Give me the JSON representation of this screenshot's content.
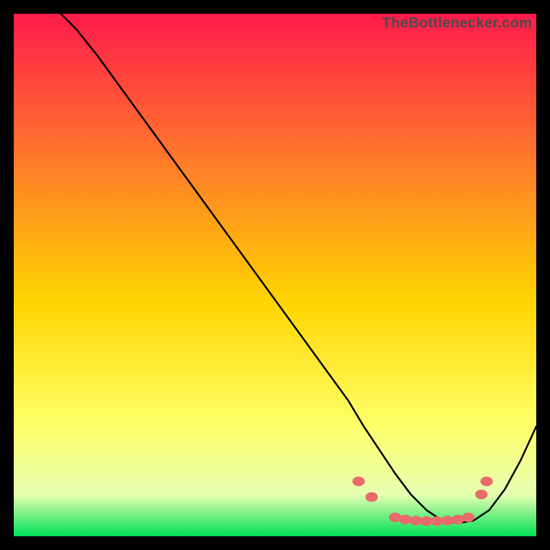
{
  "watermark": "TheBottlenecker.com",
  "chart_data": {
    "type": "line",
    "title": "",
    "xlabel": "",
    "ylabel": "",
    "xlim": [
      0,
      100
    ],
    "ylim": [
      0,
      100
    ],
    "grid": false,
    "background_gradient": {
      "top": "#ff1a4b",
      "mid_upper": "#ff7a2a",
      "mid": "#ffd400",
      "mid_lower": "#ffff66",
      "bottom": "#00e05a"
    },
    "series": [
      {
        "name": "bottleneck-curve",
        "color": "#000000",
        "x": [
          9,
          12,
          16,
          20,
          24,
          28,
          32,
          36,
          40,
          44,
          48,
          52,
          56,
          60,
          64,
          67,
          70,
          73,
          76,
          79,
          82,
          85,
          88,
          91,
          94,
          97,
          100
        ],
        "y": [
          100,
          97,
          92,
          86.5,
          81,
          75.5,
          70,
          64.5,
          59,
          53.5,
          48,
          42.5,
          37,
          31.5,
          26,
          21,
          16.5,
          12,
          8,
          5,
          3,
          2.5,
          3,
          5,
          9,
          14.5,
          21
        ]
      }
    ],
    "markers": {
      "name": "highlight-dots",
      "color": "#e86a6a",
      "points": [
        {
          "x": 66,
          "y": 10.5
        },
        {
          "x": 68.5,
          "y": 7.5
        },
        {
          "x": 73,
          "y": 3.6
        },
        {
          "x": 75,
          "y": 3.2
        },
        {
          "x": 77,
          "y": 3.0
        },
        {
          "x": 79,
          "y": 2.9
        },
        {
          "x": 81,
          "y": 2.9
        },
        {
          "x": 83,
          "y": 3.0
        },
        {
          "x": 85,
          "y": 3.2
        },
        {
          "x": 87,
          "y": 3.6
        },
        {
          "x": 89.5,
          "y": 8.0
        },
        {
          "x": 90.5,
          "y": 10.5
        }
      ]
    }
  }
}
